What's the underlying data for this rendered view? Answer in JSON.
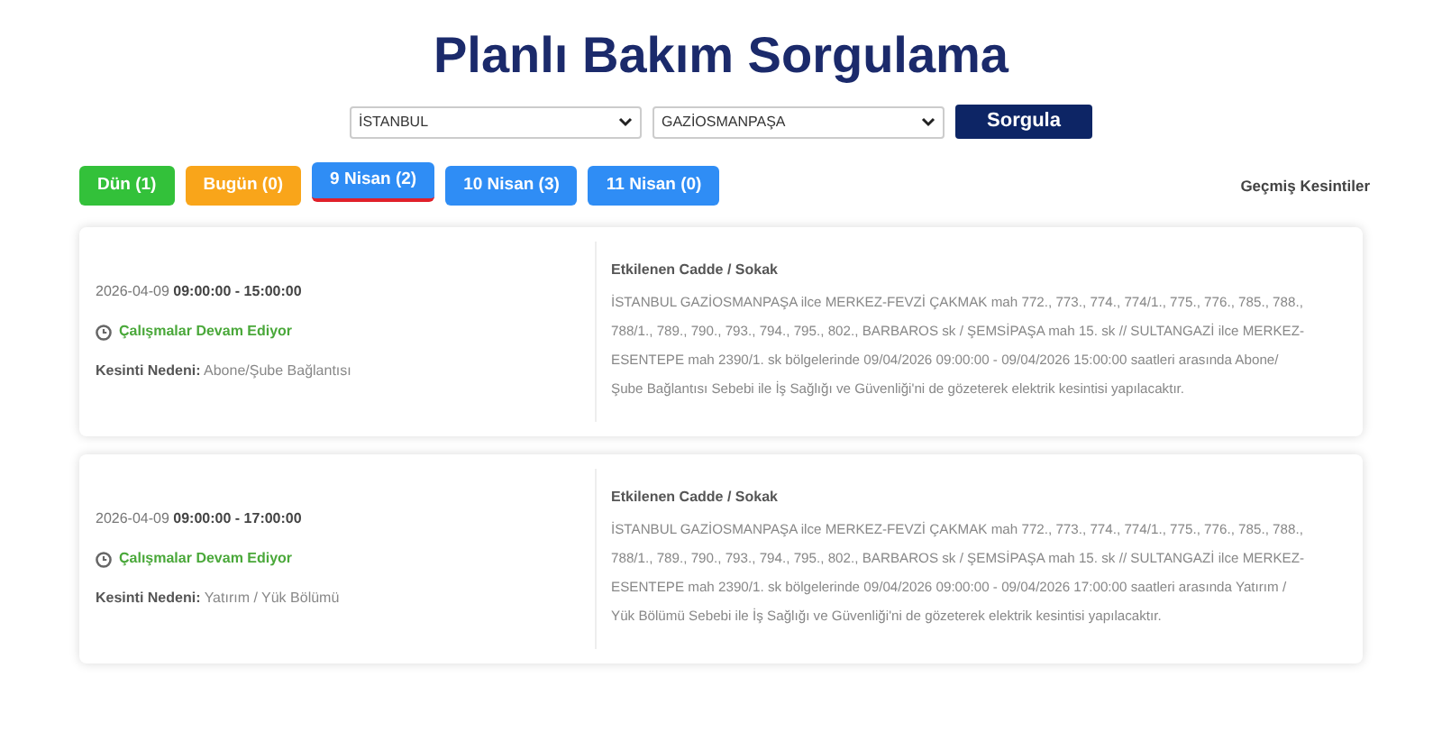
{
  "title": "Planlı Bakım Sorgulama",
  "filters": {
    "city": "İSTANBUL",
    "district": "GAZİOSMANPAŞA",
    "button": "Sorgula"
  },
  "tabs": [
    {
      "label": "Dün (1)",
      "color": "#33c13a",
      "selected": false
    },
    {
      "label": "Bugün (0)",
      "color": "#f9a51a",
      "selected": false
    },
    {
      "label": "9 Nisan (2)",
      "color": "#2f8df5",
      "selected": true
    },
    {
      "label": "10 Nisan (3)",
      "color": "#2f8df5",
      "selected": false
    },
    {
      "label": "11 Nisan (0)",
      "color": "#2f8df5",
      "selected": false
    }
  ],
  "history_link": "Geçmiş Kesintiler",
  "outages": [
    {
      "date": "2026-04-09",
      "time": "09:00:00 - 15:00:00",
      "status": "Çalışmalar Devam Ediyor",
      "reason_label": "Kesinti Nedeni:",
      "reason": "Abone/Şube Bağlantısı",
      "streets_label": "Etkilenen Cadde / Sokak",
      "streets": "İSTANBUL GAZİOSMANPAŞA ilce MERKEZ-FEVZİ ÇAKMAK mah 772., 773., 774., 774/1., 775., 776., 785., 788., 788/1., 789., 790., 793., 794., 795., 802., BARBAROS sk / ŞEMSİPAŞA mah 15. sk // SULTANGAZİ ilce MERKEZ-ESENTEPE mah 2390/1. sk bölgelerinde 09/04/2026 09:00:00 - 09/04/2026 15:00:00 saatleri arasında Abone/Şube Bağlantısı Sebebi ile İş Sağlığı ve Güvenliği'ni de gözeterek elektrik kesintisi yapılacaktır."
    },
    {
      "date": "2026-04-09",
      "time": "09:00:00 - 17:00:00",
      "status": "Çalışmalar Devam Ediyor",
      "reason_label": "Kesinti Nedeni:",
      "reason": "Yatırım / Yük Bölümü",
      "streets_label": "Etkilenen Cadde / Sokak",
      "streets": "İSTANBUL GAZİOSMANPAŞA ilce MERKEZ-FEVZİ ÇAKMAK mah 772., 773., 774., 774/1., 775., 776., 785., 788., 788/1., 789., 790., 793., 794., 795., 802., BARBAROS sk / ŞEMSİPAŞA mah 15. sk // SULTANGAZİ ilce MERKEZ-ESENTEPE mah 2390/1. sk bölgelerinde 09/04/2026 09:00:00 - 09/04/2026 17:00:00 saatleri arasında Yatırım / Yük Bölümü Sebebi ile İş Sağlığı ve Güvenliği'ni de gözeterek elektrik kesintisi yapılacaktır."
    }
  ]
}
